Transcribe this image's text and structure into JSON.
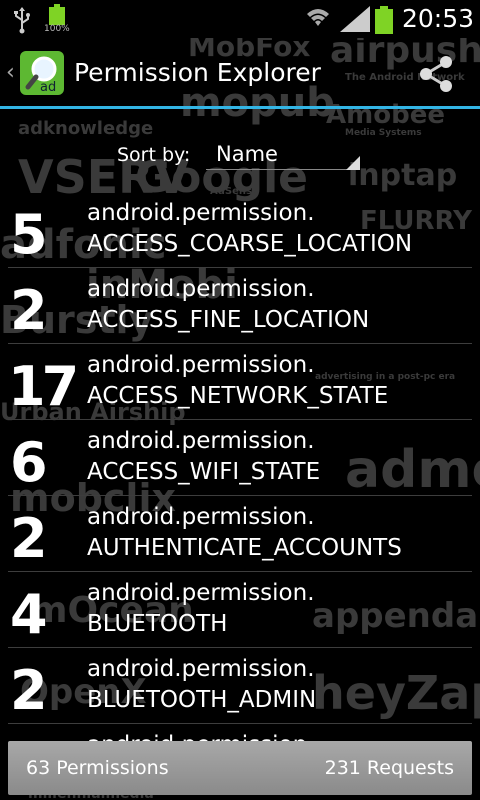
{
  "status": {
    "battery_small_label": "100%",
    "time": "20:53"
  },
  "actionbar": {
    "title": "Permission Explorer",
    "app_icon_text": "ad"
  },
  "sort": {
    "label": "Sort by:",
    "value": "Name"
  },
  "permissions": [
    {
      "count": "5",
      "prefix": "android.permission.",
      "name": "ACCESS_COARSE_LOCATION"
    },
    {
      "count": "2",
      "prefix": "android.permission.",
      "name": "ACCESS_FINE_LOCATION"
    },
    {
      "count": "17",
      "prefix": "android.permission.",
      "name": "ACCESS_NETWORK_STATE"
    },
    {
      "count": "6",
      "prefix": "android.permission.",
      "name": "ACCESS_WIFI_STATE"
    },
    {
      "count": "2",
      "prefix": "android.permission.",
      "name": "AUTHENTICATE_ACCOUNTS"
    },
    {
      "count": "4",
      "prefix": "android.permission.",
      "name": "BLUETOOTH"
    },
    {
      "count": "2",
      "prefix": "android.permission.",
      "name": "BLUETOOTH_ADMIN"
    },
    {
      "count": "",
      "prefix": "android.permission.",
      "name": ""
    }
  ],
  "footer": {
    "permissions_total": "63 Permissions",
    "requests_total": "231 Requests"
  },
  "background_logos": [
    "MobFox",
    "airpush",
    "The Android Network",
    "mopub",
    "adknowledge",
    "Amobee",
    "Media Systems",
    "VSERV",
    "Google",
    "AdSense",
    "inptap",
    "FLURRY",
    "adfonic",
    "inMobi",
    "Burstly",
    "admob",
    "Urban Airship",
    "mobclix",
    "appenda",
    "mOcean",
    "OpenX",
    "heyZap",
    "millennialmedia",
    "advertising in a post-pc era"
  ],
  "colors": {
    "accent": "#33b5e5",
    "battery": "#7fd325",
    "footer_bg": "#999999"
  }
}
